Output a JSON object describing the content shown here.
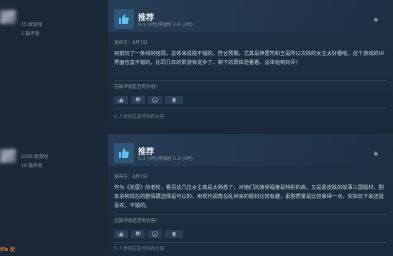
{
  "reviews": [
    {
      "author_meta": [
        "15 款游戏",
        "1 篇评测"
      ],
      "verdict": "推荐",
      "hours": "9.3 小时(评测时 2.6 小时)",
      "posted": "发布于：8月7日",
      "body": "目前玩了一条线的结局，总体来说挺不错的，符合预期，尤其是神居司和王是所以次的的女主太好看啦。这个游戏的UI界面也蛮不错的，比同几年的影游有进步了，剩下的再体验看看，总体给到好评！",
      "helpful_question": "这篇评测是否有价值？",
      "votes": [
        "是",
        "否",
        "欢乐",
        "奖励"
      ],
      "footer": "4 人觉得这篇评测有价值"
    },
    {
      "author_meta": [
        "2300 款游戏",
        "16 篇评测"
      ],
      "verdict": "推荐",
      "hours": "5.3 小时(评测时 5.3 小时)",
      "posted": "发布于：8月7日",
      "body": "作为《完蛋》的老粉，看见这几位女主真是太熟悉了，对她们的接受程度是特别的高，又是素皮肤的故事三国题材，剧本杀和现在的剧情跟选择是可以的，用现代视角在乱世来的题材比较有趣，素剧质量是比较拿得一点，实际玩下来还挺喜欢，不错的。",
      "helpful_question": "这篇评测是否有价值？",
      "votes": [
        "是",
        "否",
        "欢乐",
        "奖励"
      ],
      "footer": "5 人觉得这篇评测有价值"
    }
  ],
  "watermark": "iFe 玩"
}
